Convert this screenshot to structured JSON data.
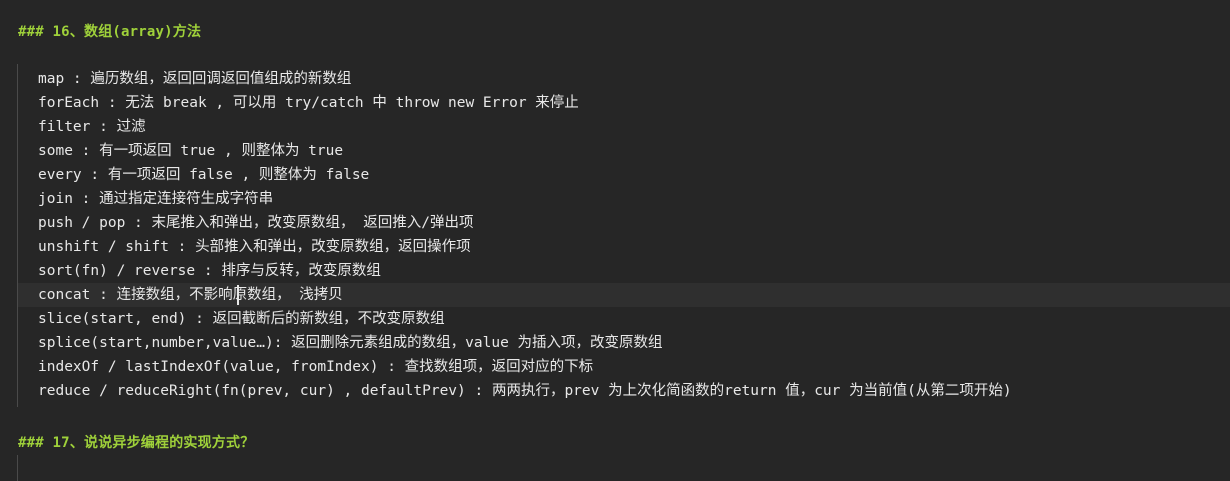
{
  "heading1": {
    "hash": "###",
    "text": "16、数组(array)方法"
  },
  "lines": [
    "map : 遍历数组，返回回调返回值组成的新数组",
    "forEach : 无法 break , 可以用 try/catch 中 throw new Error 来停止",
    "filter : 过滤",
    "some : 有一项返回 true , 则整体为 true",
    "every : 有一项返回 false , 则整体为 false",
    "join : 通过指定连接符生成字符串",
    "push / pop : 末尾推入和弹出，改变原数组， 返回推入/弹出项",
    "unshift / shift : 头部推入和弹出，改变原数组，返回操作项",
    "sort(fn) / reverse : 排序与反转，改变原数组",
    "concat : 连接数组，不影响原数组， 浅拷贝",
    "slice(start, end) : 返回截断后的新数组，不改变原数组",
    "splice(start,number,value…): 返回删除元素组成的数组，value 为插入项，改变原数组",
    "indexOf / lastIndexOf(value, fromIndex) : 查找数组项，返回对应的下标",
    "reduce / reduceRight(fn(prev, cur) , defaultPrev) : 两两执行，prev 为上次化简函数的return 值，cur 为当前值(从第二项开始)"
  ],
  "heading2": {
    "hash": "###",
    "text": "17、说说异步编程的实现方式？"
  }
}
